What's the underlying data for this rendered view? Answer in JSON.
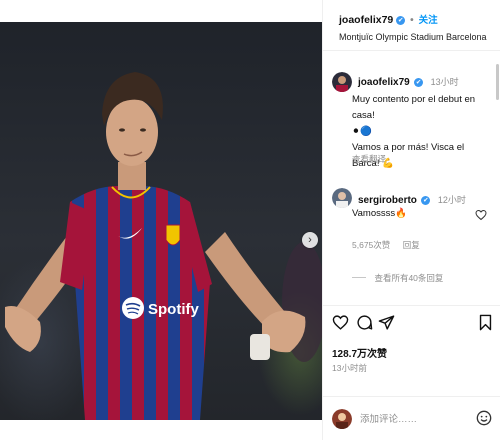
{
  "post": {
    "username": "joaofelix79",
    "verified_mark": "✔",
    "separator": "•",
    "follow_label": "关注",
    "location": "Montjuïc Olympic Stadium Barcelona"
  },
  "caption": {
    "username": "joaofelix79",
    "time": "13小时",
    "line1": "Muy contento por el debut en casa!",
    "line2_emoji": "⚫🔵",
    "line3": "Vamos a por más! Visca el Barca!",
    "line3_emoji": "💪",
    "translate_label": "查看翻译"
  },
  "comment": {
    "username": "sergiroberto",
    "time": "12小时",
    "text": "Vamossss",
    "text_emoji": "🔥",
    "likes": "5,675次赞",
    "reply_label": "回复",
    "view_replies_label": "查看所有40条回复"
  },
  "stats": {
    "likes": "128.7万次赞",
    "time": "13小时前"
  },
  "composer": {
    "placeholder": "添加评论……",
    "emoji_icon": "smiley-icon"
  },
  "media": {
    "sponsor_text": "Spotify",
    "carousel_dots": 3,
    "active_dot": 0
  },
  "colors": {
    "accent": "#0095f6",
    "verified": "#3897f0",
    "barca_blue": "#1f3f8f",
    "barca_red": "#a5143a"
  }
}
